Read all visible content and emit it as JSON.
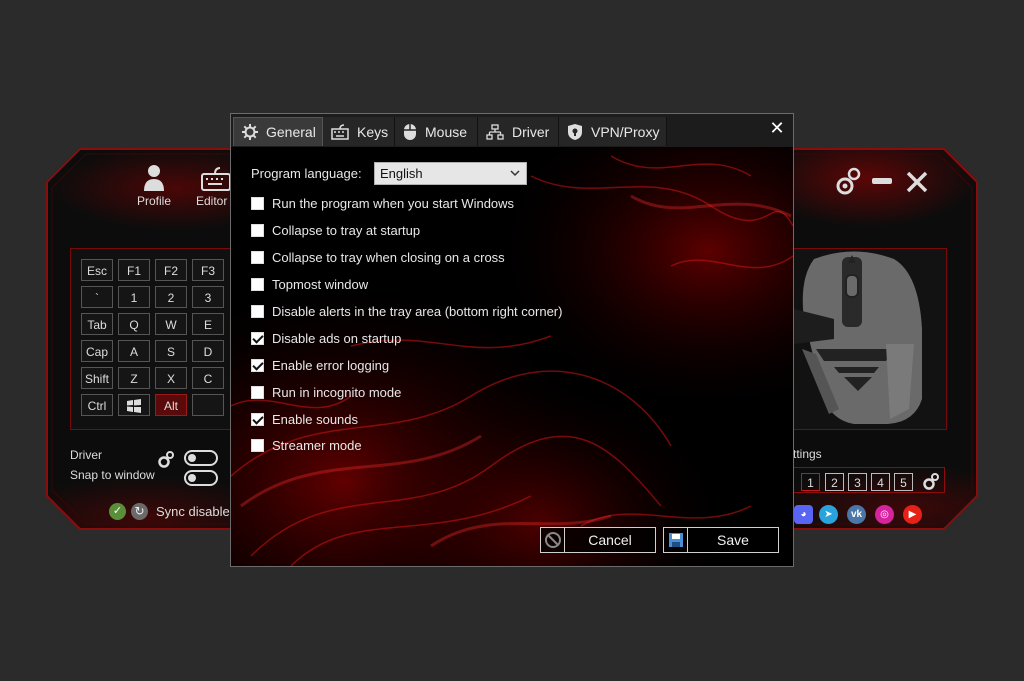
{
  "background_app": {
    "top_buttons": [
      {
        "label": "Profile",
        "icon": "user-icon"
      },
      {
        "label": "Editor",
        "icon": "keyboard-icon"
      }
    ],
    "keyboard_keys": [
      [
        "Esc",
        "F1",
        "F2",
        "F3"
      ],
      [
        "`",
        "1",
        "2",
        "3"
      ],
      [
        "Tab",
        "Q",
        "W",
        "E"
      ],
      [
        "Cap",
        "A",
        "S",
        "D"
      ],
      [
        "Shift",
        "Z",
        "X",
        "C"
      ],
      [
        "Ctrl",
        "",
        "Alt",
        ""
      ]
    ],
    "driver_label": "Driver",
    "snap_label": "Snap to window",
    "sync_label": "Sync disabled",
    "profiles_label": "ttings",
    "profile_numbers": [
      "1",
      "2",
      "3",
      "4",
      "5"
    ],
    "social_icons": [
      "discord-icon",
      "telegram-icon",
      "vk-icon",
      "instagram-icon",
      "youtube-icon"
    ]
  },
  "dialog": {
    "tabs": [
      {
        "label": "General",
        "icon": "gear-icon",
        "selected": true
      },
      {
        "label": "Keys",
        "icon": "keyboard-icon",
        "selected": false
      },
      {
        "label": "Mouse",
        "icon": "mouse-icon",
        "selected": false
      },
      {
        "label": "Driver",
        "icon": "network-icon",
        "selected": false
      },
      {
        "label": "VPN/Proxy",
        "icon": "shield-icon",
        "selected": false
      }
    ],
    "language_label": "Program language:",
    "language_value": "English",
    "options": [
      {
        "label": "Run the program when you start Windows",
        "checked": false
      },
      {
        "label": "Collapse to tray at startup",
        "checked": false
      },
      {
        "label": "Collapse to tray when closing on a cross",
        "checked": false
      },
      {
        "label": "Topmost window",
        "checked": false
      },
      {
        "label": "Disable alerts in the tray area (bottom right corner)",
        "checked": false
      },
      {
        "label": "Disable ads on startup",
        "checked": true
      },
      {
        "label": "Enable error logging",
        "checked": true
      },
      {
        "label": "Run in incognito mode",
        "checked": false
      },
      {
        "label": "Enable sounds",
        "checked": true
      },
      {
        "label": "Streamer mode",
        "checked": false
      }
    ],
    "cancel_label": "Cancel",
    "save_label": "Save"
  },
  "colors": {
    "page_background": "#2b2b2b",
    "accent_red": "#c21a1a",
    "dialog_background": "#000000"
  }
}
